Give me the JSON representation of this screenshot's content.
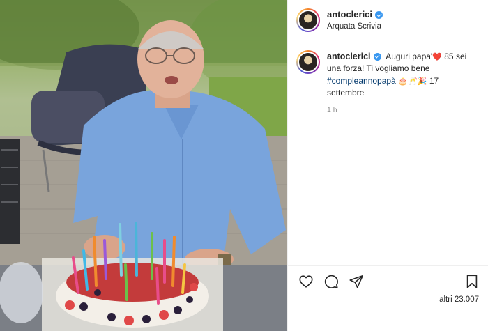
{
  "photo": {
    "description_icon": "birthday-photo"
  },
  "header": {
    "username": "antoclerici",
    "location": "Arquata Scrivia",
    "verified_icon": "verified-badge-icon"
  },
  "comment": {
    "username": "antoclerici",
    "text_part1": "Auguri papa'",
    "heart": "❤️",
    "text_part2": " 85 sei una forza! Ti vogliamo bene ",
    "hashtag": "#compleannopapà",
    "emojis": " 🎂🥂🎉 ",
    "text_part3": "17 settembre",
    "time": "1 h"
  },
  "actions": {
    "like_icon": "heart-outline-icon",
    "comment_icon": "comment-bubble-icon",
    "share_icon": "paper-plane-icon",
    "save_icon": "bookmark-icon",
    "likes_text": "altri 23.007"
  },
  "colors": {
    "accent_link": "#00376b",
    "verified": "#3897f0",
    "meta_gray": "#8e8e8e"
  }
}
